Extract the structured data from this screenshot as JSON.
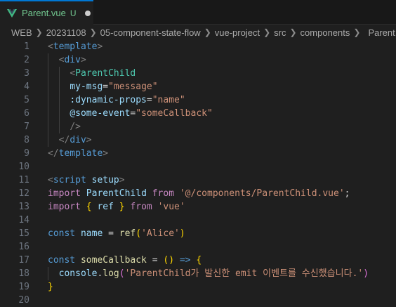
{
  "tab": {
    "filename": "Parent.vue",
    "status": "U"
  },
  "breadcrumb": [
    "WEB",
    "20231108",
    "05-component-state-flow",
    "vue-project",
    "src",
    "components",
    "Parent.vue"
  ],
  "colors": {
    "accent": "#0078d4",
    "git_untracked": "#73c991",
    "vue_logo": "#41b883"
  },
  "editor": {
    "line_numbers": [
      "1",
      "2",
      "3",
      "4",
      "5",
      "6",
      "7",
      "8",
      "9",
      "10",
      "11",
      "12",
      "13",
      "14",
      "15",
      "16",
      "17",
      "18",
      "19",
      "20"
    ],
    "lines": [
      [
        {
          "t": "<",
          "c": "t-tag"
        },
        {
          "t": "template",
          "c": "t-name"
        },
        {
          "t": ">",
          "c": "t-tag"
        }
      ],
      [
        {
          "t": "  "
        },
        {
          "t": "<",
          "c": "t-tag"
        },
        {
          "t": "div",
          "c": "t-name"
        },
        {
          "t": ">",
          "c": "t-tag"
        }
      ],
      [
        {
          "t": "    "
        },
        {
          "t": "<",
          "c": "t-tag"
        },
        {
          "t": "ParentChild",
          "c": "t-comp"
        }
      ],
      [
        {
          "t": "    "
        },
        {
          "t": "my-msg",
          "c": "t-attr"
        },
        {
          "t": "=",
          "c": "t-op"
        },
        {
          "t": "\"message\"",
          "c": "t-str"
        }
      ],
      [
        {
          "t": "    "
        },
        {
          "t": ":dynamic-props",
          "c": "t-attr"
        },
        {
          "t": "=",
          "c": "t-op"
        },
        {
          "t": "\"name\"",
          "c": "t-str"
        }
      ],
      [
        {
          "t": "    "
        },
        {
          "t": "@some-event",
          "c": "t-attr"
        },
        {
          "t": "=",
          "c": "t-op"
        },
        {
          "t": "\"someCallback\"",
          "c": "t-str"
        }
      ],
      [
        {
          "t": "    "
        },
        {
          "t": "/>",
          "c": "t-tag"
        }
      ],
      [
        {
          "t": "  "
        },
        {
          "t": "</",
          "c": "t-tag"
        },
        {
          "t": "div",
          "c": "t-name"
        },
        {
          "t": ">",
          "c": "t-tag"
        }
      ],
      [
        {
          "t": "</",
          "c": "t-tag"
        },
        {
          "t": "template",
          "c": "t-name"
        },
        {
          "t": ">",
          "c": "t-tag"
        }
      ],
      [],
      [
        {
          "t": "<",
          "c": "t-tag"
        },
        {
          "t": "script",
          "c": "t-name"
        },
        {
          "t": " "
        },
        {
          "t": "setup",
          "c": "t-attr"
        },
        {
          "t": ">",
          "c": "t-tag"
        }
      ],
      [
        {
          "t": "import",
          "c": "t-kw"
        },
        {
          "t": " "
        },
        {
          "t": "ParentChild",
          "c": "t-var"
        },
        {
          "t": " "
        },
        {
          "t": "from",
          "c": "t-kw"
        },
        {
          "t": " "
        },
        {
          "t": "'@/components/ParentChild.vue'",
          "c": "t-str"
        },
        {
          "t": ";",
          "c": "t-op"
        }
      ],
      [
        {
          "t": "import",
          "c": "t-kw"
        },
        {
          "t": " "
        },
        {
          "t": "{",
          "c": "t-brace"
        },
        {
          "t": " "
        },
        {
          "t": "ref",
          "c": "t-var"
        },
        {
          "t": " "
        },
        {
          "t": "}",
          "c": "t-brace"
        },
        {
          "t": " "
        },
        {
          "t": "from",
          "c": "t-kw"
        },
        {
          "t": " "
        },
        {
          "t": "'vue'",
          "c": "t-str"
        }
      ],
      [],
      [
        {
          "t": "const",
          "c": "t-dec"
        },
        {
          "t": " "
        },
        {
          "t": "name",
          "c": "t-var"
        },
        {
          "t": " = ",
          "c": "t-op"
        },
        {
          "t": "ref",
          "c": "t-fn"
        },
        {
          "t": "(",
          "c": "t-brace"
        },
        {
          "t": "'Alice'",
          "c": "t-str"
        },
        {
          "t": ")",
          "c": "t-brace"
        }
      ],
      [],
      [
        {
          "t": "const",
          "c": "t-dec"
        },
        {
          "t": " "
        },
        {
          "t": "someCallback",
          "c": "t-fn"
        },
        {
          "t": " = ",
          "c": "t-op"
        },
        {
          "t": "()",
          "c": "t-brace"
        },
        {
          "t": " "
        },
        {
          "t": "=>",
          "c": "t-dec"
        },
        {
          "t": " "
        },
        {
          "t": "{",
          "c": "t-brace"
        }
      ],
      [
        {
          "t": "  "
        },
        {
          "t": "console",
          "c": "t-var"
        },
        {
          "t": ".",
          "c": "t-op"
        },
        {
          "t": "log",
          "c": "t-fn"
        },
        {
          "t": "(",
          "c": "t-brace2"
        },
        {
          "t": "'ParentChild가 발신한 emit 이벤트를 수신했습니다.'",
          "c": "t-str"
        },
        {
          "t": ")",
          "c": "t-brace2"
        }
      ],
      [
        {
          "t": "}",
          "c": "t-brace"
        }
      ],
      []
    ]
  }
}
